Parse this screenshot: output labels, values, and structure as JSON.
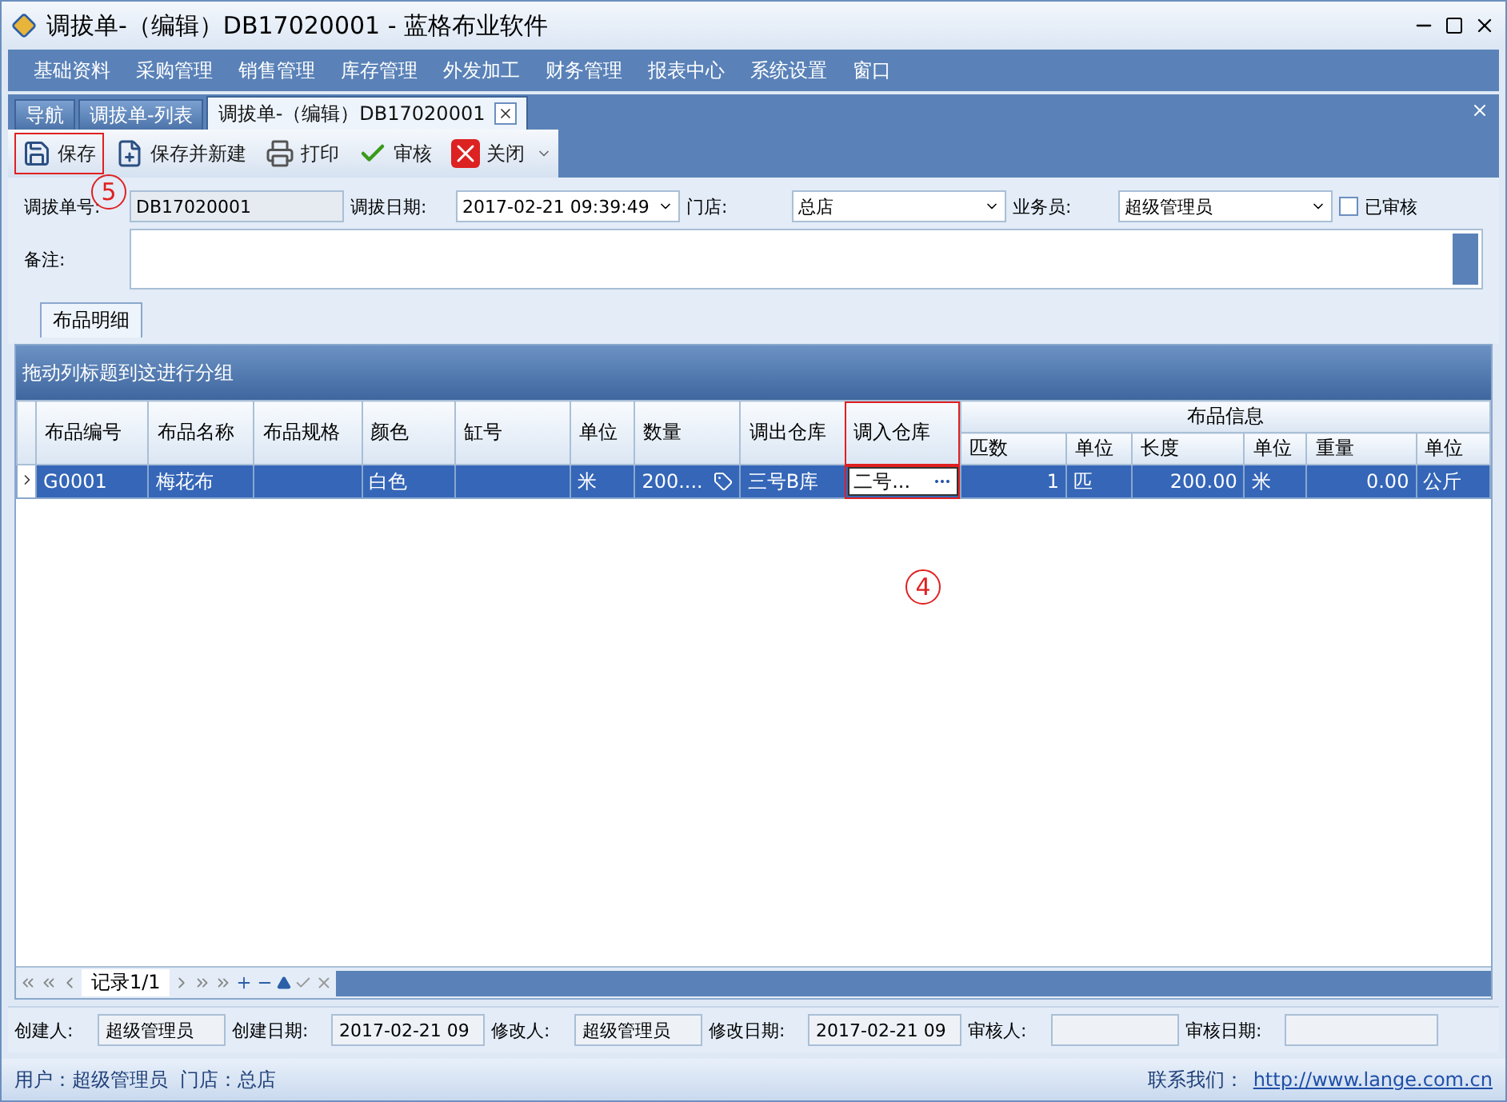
{
  "window": {
    "title": "调拔单-（编辑）DB17020001 - 蓝格布业软件"
  },
  "menu": [
    "基础资料",
    "采购管理",
    "销售管理",
    "库存管理",
    "外发加工",
    "财务管理",
    "报表中心",
    "系统设置",
    "窗口"
  ],
  "tabs": [
    {
      "label": "导航",
      "selected": false,
      "closable": false
    },
    {
      "label": "调拔单-列表",
      "selected": false,
      "closable": false
    },
    {
      "label": "调拔单-（编辑）DB17020001",
      "selected": true,
      "closable": true
    }
  ],
  "toolbar": [
    {
      "label": "保存",
      "kind": "save",
      "highlighted": true
    },
    {
      "label": "保存并新建",
      "kind": "save-new",
      "highlighted": false
    },
    {
      "label": "打印",
      "kind": "print",
      "highlighted": false
    },
    {
      "label": "审核",
      "kind": "approve",
      "highlighted": false
    },
    {
      "label": "关闭",
      "kind": "close",
      "highlighted": false
    }
  ],
  "annotations": [
    {
      "label": "5",
      "kind": "toolbar"
    },
    {
      "label": "4",
      "kind": "grid"
    }
  ],
  "form": {
    "fields": [
      {
        "label": "调拔单号:",
        "value": "DB17020001",
        "kind": "readonly"
      },
      {
        "label": "调拔日期:",
        "value": "2017-02-21 09:39:49",
        "kind": "dropdown"
      },
      {
        "label": "门店:",
        "value": "总店",
        "kind": "dropdown"
      },
      {
        "label": "业务员:",
        "value": "超级管理员",
        "kind": "dropdown"
      }
    ],
    "approved": {
      "label": "已审核",
      "checked": false
    },
    "remark": {
      "label": "备注:"
    }
  },
  "detail_tab": {
    "label": "布品明细",
    "selected": true
  },
  "grid": {
    "group_panel": "拖动列标题到这进行分组",
    "columns": [
      "布品编号",
      "布品名称",
      "布品规格",
      "颜色",
      "缸号",
      "单位",
      "数量",
      "调出仓库",
      "调入仓库"
    ],
    "column_group": {
      "label": "布品信息",
      "columns": [
        "匹数",
        "单位",
        "长度",
        "单位",
        "重量",
        "单位"
      ]
    },
    "rows": [
      {
        "selected": true,
        "cells": [
          {
            "kind": "text",
            "text": "G0001"
          },
          {
            "kind": "text",
            "text": "梅花布"
          },
          {
            "kind": "text"
          },
          {
            "kind": "text",
            "text": "白色"
          },
          {
            "kind": "text"
          },
          {
            "kind": "text",
            "text": "米"
          },
          {
            "kind": "spin",
            "text": "200...."
          },
          {
            "kind": "text",
            "text": "三号B库"
          },
          {
            "kind": "editor",
            "text": "二号..."
          },
          {
            "kind": "number",
            "text": "1"
          },
          {
            "kind": "text",
            "text": "匹"
          },
          {
            "kind": "number",
            "text": "200.00"
          },
          {
            "kind": "text",
            "text": "米"
          },
          {
            "kind": "number",
            "text": "0.00"
          },
          {
            "kind": "text",
            "text": "公斤"
          }
        ]
      }
    ],
    "navigator": {
      "record": "记录1/1"
    }
  },
  "footer": [
    {
      "label": "创建人:",
      "value": "超级管理员"
    },
    {
      "label": "创建日期:",
      "value": "2017-02-21 09"
    },
    {
      "label": "修改人:",
      "value": "超级管理员"
    },
    {
      "label": "修改日期:",
      "value": "2017-02-21 09"
    },
    {
      "label": "审核人:"
    },
    {
      "label": "审核日期:"
    }
  ],
  "status_bar": {
    "user": "用户：超级管理员  门店：总店",
    "contact": "联系我们：",
    "link": "http://www.lange.com.cn"
  }
}
